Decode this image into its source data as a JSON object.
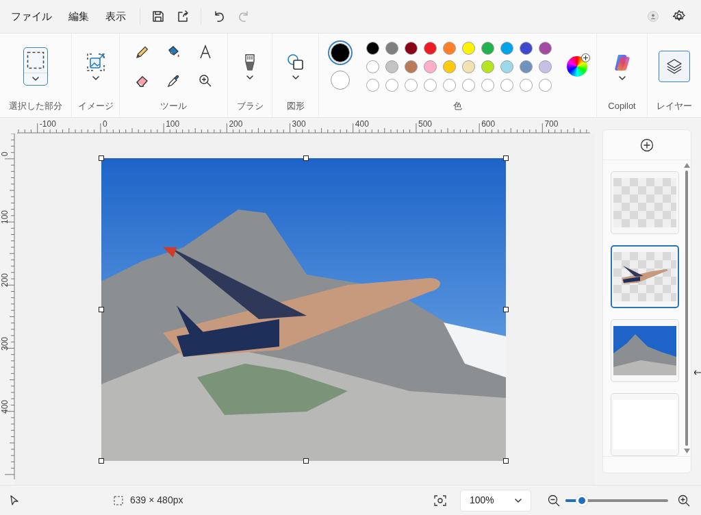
{
  "menu": [
    {
      "label": "ファイル"
    },
    {
      "label": "編集"
    },
    {
      "label": "表示"
    }
  ],
  "quick_actions": [
    {
      "kind": "save",
      "disabled": false
    },
    {
      "kind": "share",
      "disabled": false
    },
    {
      "kind": "undo",
      "disabled": false
    },
    {
      "kind": "redo",
      "disabled": true
    }
  ],
  "ribbon": {
    "selection": {
      "label": "選択した部分",
      "selected": true
    },
    "image": {
      "label": "イメージ"
    },
    "tools": {
      "label": "ツール",
      "items": [
        {
          "kind": "pencil"
        },
        {
          "kind": "fill"
        },
        {
          "kind": "text"
        },
        {
          "kind": "eraser"
        },
        {
          "kind": "picker"
        },
        {
          "kind": "zoom"
        }
      ]
    },
    "brushes": {
      "label": "ブラシ"
    },
    "shapes": {
      "label": "図形"
    },
    "colors": {
      "label": "色",
      "primary": {
        "color": "#000000",
        "selected": true
      },
      "secondary": {
        "color": "#ffffff",
        "selected": false
      },
      "palette": [
        {
          "kind": "color",
          "color": "#000000"
        },
        {
          "kind": "color",
          "color": "#7f7f7f"
        },
        {
          "kind": "color",
          "color": "#880015"
        },
        {
          "kind": "color",
          "color": "#ed1c24"
        },
        {
          "kind": "color",
          "color": "#ff7f27"
        },
        {
          "kind": "color",
          "color": "#fff200"
        },
        {
          "kind": "color",
          "color": "#22b14c"
        },
        {
          "kind": "color",
          "color": "#00a2e8"
        },
        {
          "kind": "color",
          "color": "#3f48cc"
        },
        {
          "kind": "color",
          "color": "#a349a4"
        },
        {
          "kind": "color",
          "color": "#ffffff"
        },
        {
          "kind": "color",
          "color": "#c3c3c3"
        },
        {
          "kind": "color",
          "color": "#b97a57"
        },
        {
          "kind": "color",
          "color": "#ffaec9"
        },
        {
          "kind": "color",
          "color": "#ffc90e"
        },
        {
          "kind": "color",
          "color": "#efe4b0"
        },
        {
          "kind": "color",
          "color": "#b5e61d"
        },
        {
          "kind": "color",
          "color": "#99d9ea"
        },
        {
          "kind": "color",
          "color": "#7092be"
        },
        {
          "kind": "color",
          "color": "#c8bfe7"
        },
        {
          "kind": "empty"
        },
        {
          "kind": "empty"
        },
        {
          "kind": "empty"
        },
        {
          "kind": "empty"
        },
        {
          "kind": "empty"
        },
        {
          "kind": "empty"
        },
        {
          "kind": "empty"
        },
        {
          "kind": "empty"
        },
        {
          "kind": "empty"
        },
        {
          "kind": "empty"
        }
      ]
    },
    "copilot": {
      "label": "Copilot"
    },
    "layers": {
      "label": "レイヤー",
      "selected": true
    }
  },
  "ruler": {
    "horizontal": [
      "-100",
      "0",
      "100",
      "200",
      "300",
      "400",
      "500",
      "600",
      "700"
    ],
    "vertical": [
      "0",
      "100",
      "200",
      "300",
      "400"
    ]
  },
  "layers_panel": {
    "items": [
      {
        "kind": "transparent",
        "selected": false
      },
      {
        "kind": "airplane",
        "selected": true
      },
      {
        "kind": "photo",
        "selected": false
      },
      {
        "kind": "background",
        "selected": false
      }
    ]
  },
  "status_bar": {
    "dimensions": "639 × 480px",
    "zoom": "100%",
    "zoom_slider": {
      "level": 0.16
    }
  }
}
